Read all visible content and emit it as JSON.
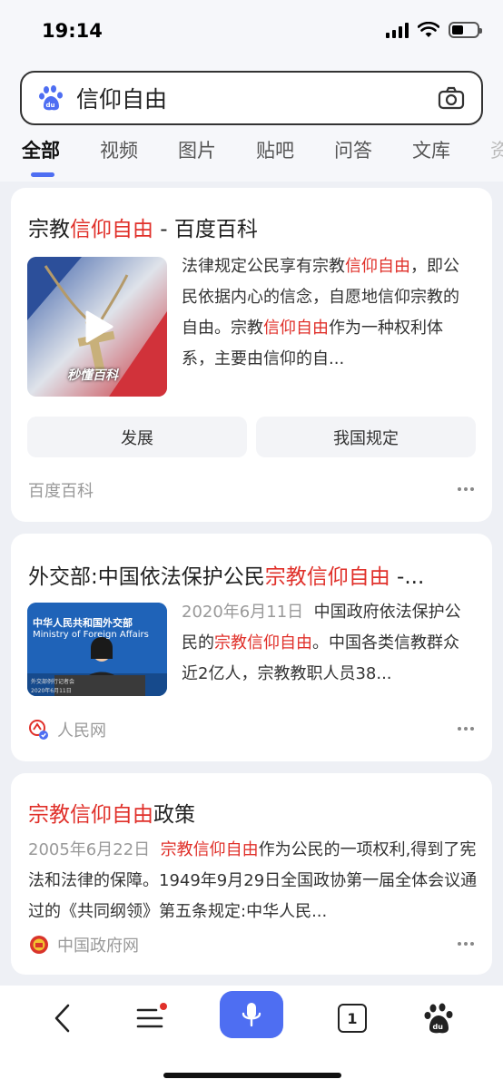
{
  "status": {
    "time": "19:14"
  },
  "search": {
    "query": "信仰自由"
  },
  "tabs": [
    {
      "label": "全部",
      "active": true
    },
    {
      "label": "视频"
    },
    {
      "label": "图片"
    },
    {
      "label": "贴吧"
    },
    {
      "label": "问答"
    },
    {
      "label": "文库"
    },
    {
      "label": "资"
    }
  ],
  "results": [
    {
      "title_prefix": "宗教",
      "title_highlight": "信仰自由",
      "title_suffix": " - 百度百科",
      "thumb_caption": "秒懂百科",
      "desc_1": "法律规定公民享有宗教",
      "desc_hl_1": "信仰自由",
      "desc_2": "，即公民依据内心的信念，自愿地信仰宗教的自由。宗教",
      "desc_hl_2": "信仰自由",
      "desc_3": "作为一种权利体系，主要由信仰的自...",
      "chips": [
        "发展",
        "我国规定"
      ],
      "source": "百度百科"
    },
    {
      "title_prefix": "外交部:中国依法保护公民",
      "title_highlight": "宗教信仰自由",
      "title_suffix": " -...",
      "thumb_title": "中华人民共和国外交部",
      "thumb_subtitle": "Ministry of Foreign Affairs",
      "thumb_small_1": "外交部例行记者会",
      "thumb_small_2": "2020年6月11日",
      "date": "2020年6月11日",
      "desc_1": "中国政府依法保护公民的",
      "desc_hl_1": "宗教信仰自由",
      "desc_2": "。中国各类信教群众近2亿人，宗教教职人员38...",
      "source": "人民网"
    },
    {
      "title_highlight": "宗教信仰自由",
      "title_suffix": "政策",
      "date": "2005年6月22日",
      "desc_hl_1": "宗教信仰自由",
      "desc_1": "作为公民的一项权利,得到了宪法和法律的保障。1949年9月29日全国政协第一届全体会议通过的《共同纲领》第五条规定:中华人民...",
      "source": "中国政府网"
    }
  ],
  "bottom_nav": {
    "tab_count": "1"
  },
  "colors": {
    "accent": "#4e6ef2",
    "highlight": "#e0302a"
  }
}
